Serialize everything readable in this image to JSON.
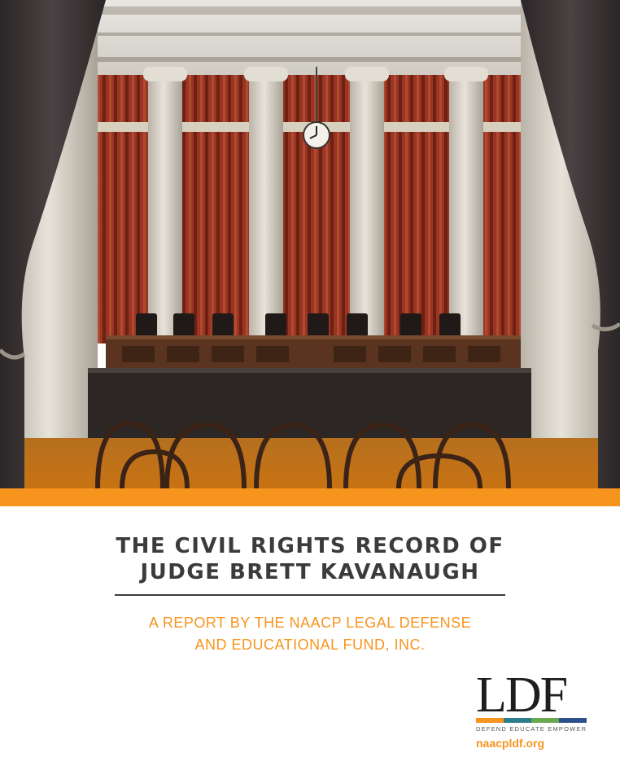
{
  "colors": {
    "accent_orange": "#f7941d",
    "title_text": "#3b3b3b",
    "logo_bar": [
      "#f7941d",
      "#2e7d8c",
      "#6aa84f",
      "#2d4f8a"
    ]
  },
  "cover": {
    "image_alt": "Supreme Court courtroom with red curtains, marble columns and bench chairs"
  },
  "report": {
    "title_line1": "THE CIVIL RIGHTS RECORD OF",
    "title_line2": "JUDGE BRETT KAVANAUGH",
    "subtitle_line1": "A REPORT BY THE NAACP LEGAL DEFENSE",
    "subtitle_line2": "AND EDUCATIONAL FUND, INC."
  },
  "logo": {
    "mark": "LDF",
    "tagline": "DEFEND EDUCATE EMPOWER",
    "url": "naacpldf.org"
  }
}
